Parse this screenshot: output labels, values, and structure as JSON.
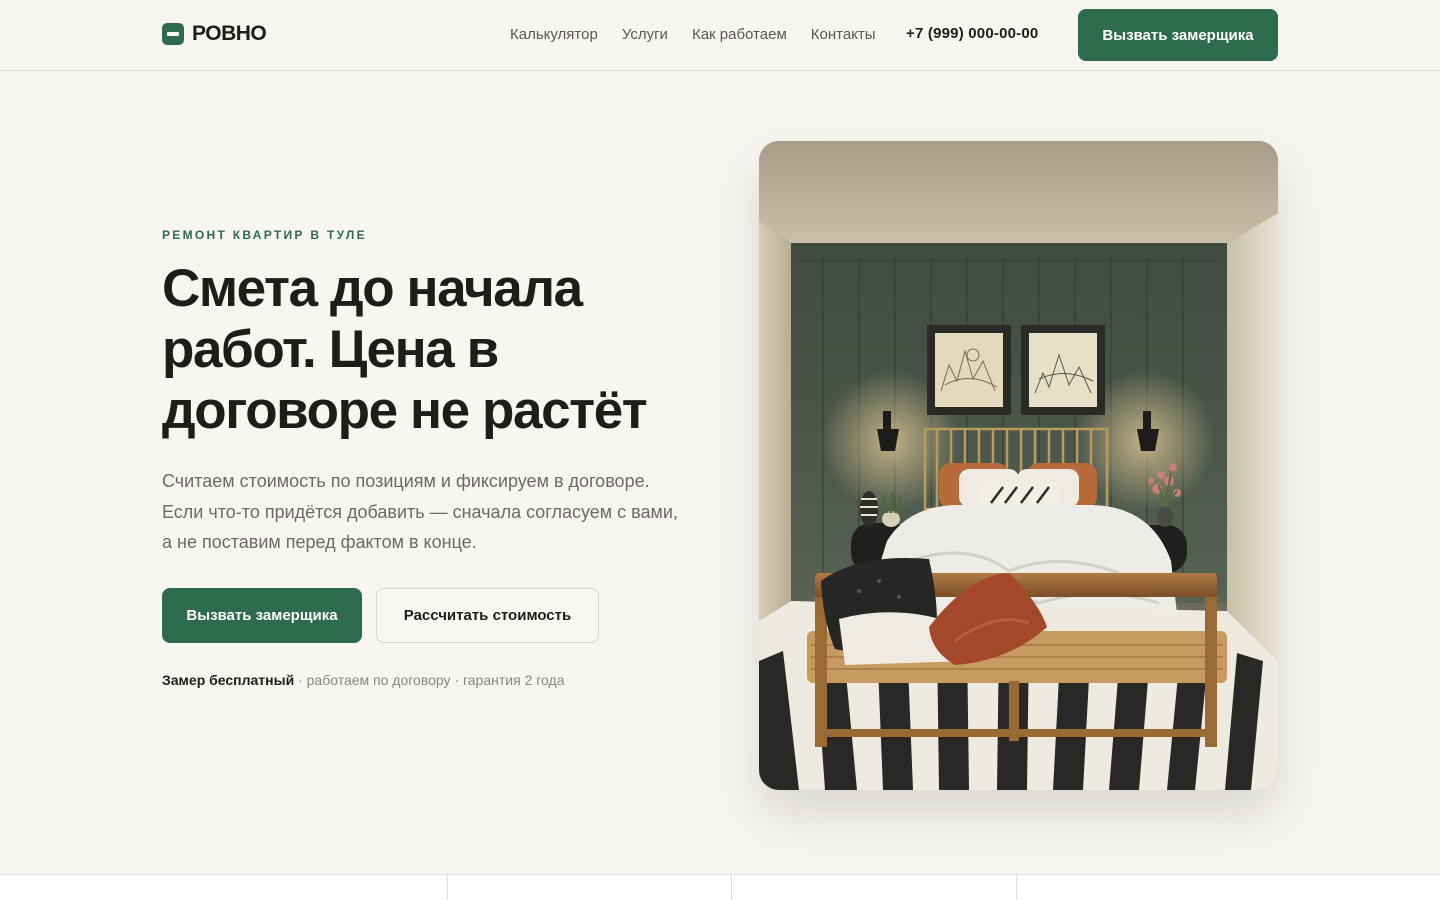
{
  "brand": {
    "name": "РОВНО",
    "accent_color": "#2e6b4d"
  },
  "nav": {
    "items": [
      {
        "label": "Калькулятор"
      },
      {
        "label": "Услуги"
      },
      {
        "label": "Как работаем"
      },
      {
        "label": "Контакты"
      }
    ],
    "phone": "+7 (999) 000-00-00",
    "cta_label": "Вызвать замерщика"
  },
  "hero": {
    "eyebrow": "РЕМОНТ КВАРТИР В ТУЛЕ",
    "headline": "Смета до начала работ. Цена в договоре не растёт",
    "lead": "Считаем стоимость по позициям и фиксируем в договоре. Если что-то придётся добавить — сначала согласуем с вами, а не поставим перед фактом в конце.",
    "primary_cta": "Вызвать замерщика",
    "secondary_cta": "Рассчитать стоимость",
    "trust_bold": "Замер бесплатный",
    "trust_rest": " · работаем по договору · гарантия 2 года"
  }
}
